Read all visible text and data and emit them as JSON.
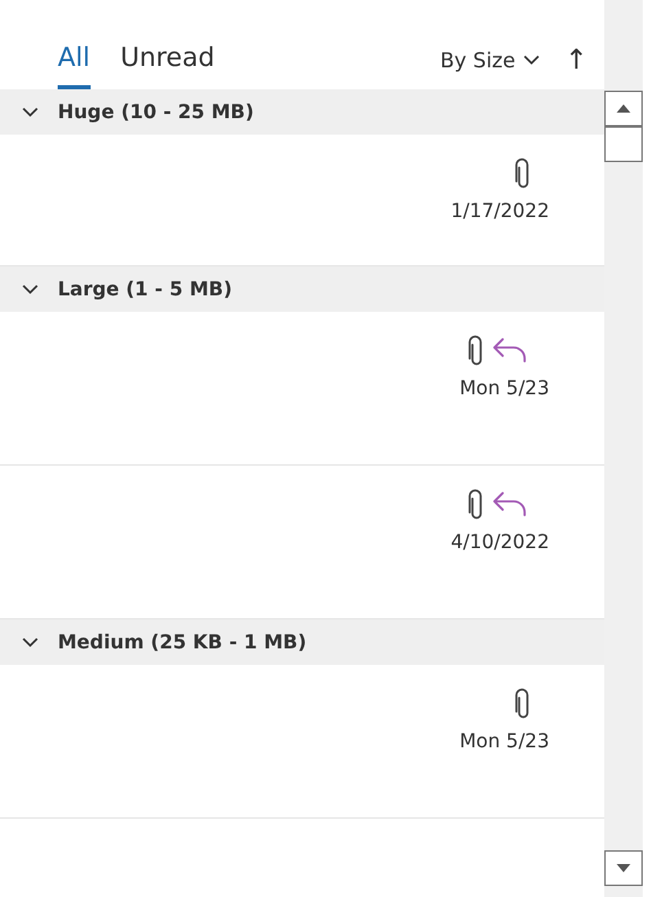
{
  "tabs": [
    {
      "label": "All",
      "selected": true
    },
    {
      "label": "Unread",
      "selected": false
    }
  ],
  "sort": {
    "label": "By Size"
  },
  "sort_direction": "↑",
  "groups": [
    {
      "label": "Huge (10 - 25 MB)",
      "expanded": true,
      "messages": [
        {
          "attachment": true,
          "replied": false,
          "date": "1/17/2022"
        }
      ]
    },
    {
      "label": "Large (1 - 5 MB)",
      "expanded": true,
      "messages": [
        {
          "attachment": true,
          "replied": true,
          "date": "Mon 5/23"
        },
        {
          "attachment": true,
          "replied": true,
          "date": "4/10/2022"
        }
      ]
    },
    {
      "label": "Medium (25 KB - 1 MB)",
      "expanded": true,
      "messages": [
        {
          "attachment": true,
          "replied": false,
          "date": "Mon 5/23"
        }
      ]
    }
  ]
}
